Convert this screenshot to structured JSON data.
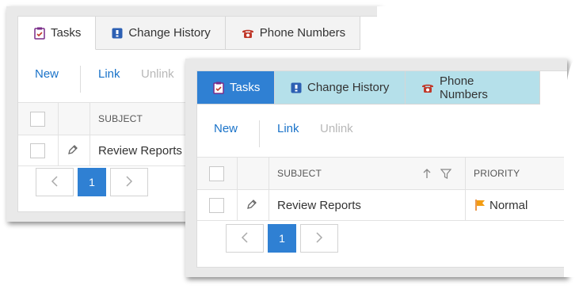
{
  "back_panel": {
    "tabs": [
      {
        "label": "Tasks",
        "icon": "clipboard-icon",
        "active": true
      },
      {
        "label": "Change History",
        "icon": "history-icon",
        "active": false
      },
      {
        "label": "Phone Numbers",
        "icon": "phone-icon",
        "active": false
      }
    ],
    "toolbar": {
      "new_label": "New",
      "link_label": "Link",
      "unlink_label": "Unlink"
    },
    "grid": {
      "columns": [
        "SUBJECT"
      ],
      "rows": [
        {
          "subject": "Review Reports"
        }
      ]
    },
    "pager": {
      "current_page": "1"
    }
  },
  "front_panel": {
    "tabs": [
      {
        "label": "Tasks",
        "icon": "clipboard-icon",
        "active": true
      },
      {
        "label": "Change History",
        "icon": "history-icon",
        "active": false
      },
      {
        "label": "Phone Numbers",
        "icon": "phone-icon",
        "active": false
      }
    ],
    "toolbar": {
      "new_label": "New",
      "link_label": "Link",
      "unlink_label": "Unlink"
    },
    "grid": {
      "columns": [
        "SUBJECT",
        "PRIORITY"
      ],
      "rows": [
        {
          "subject": "Review Reports",
          "priority": "Normal"
        }
      ]
    },
    "pager": {
      "current_page": "1"
    }
  },
  "colors": {
    "accent": "#2f80d3",
    "inactive_tab_front": "#b5e0ea",
    "link": "#1a73c9",
    "disabled": "#b8b8b8",
    "priority_flag": "#f39c12"
  }
}
